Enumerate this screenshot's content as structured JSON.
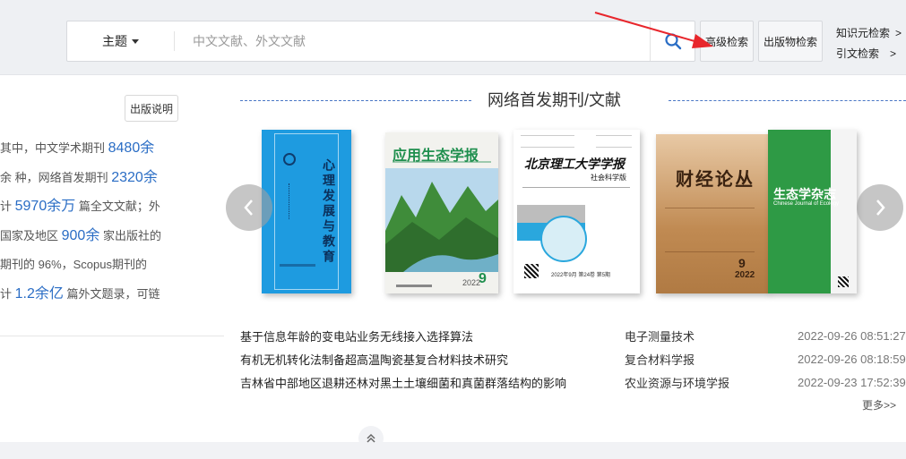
{
  "search": {
    "subject_label": "主题",
    "placeholder": "中文文献、外文文献"
  },
  "buttons": {
    "advanced": "高级检索",
    "publication": "出版物检索"
  },
  "side_links": {
    "knowledge": "知识元检索",
    "citation": "引文检索",
    "arrow": ">"
  },
  "intro": {
    "pub_note": "出版说明",
    "lines": [
      [
        "其中，中文学术期刊 ",
        "8480余",
        ""
      ],
      [
        "余 种，网络首发期刊 ",
        "2320余",
        ""
      ],
      [
        "计 ",
        "5970余万",
        " 篇全文文献；外"
      ],
      [
        "国家及地区 ",
        "900余",
        " 家出版社的"
      ],
      [
        "期刊的 96%，Scopus期刊的",
        "",
        ""
      ],
      [
        "计 ",
        "1.2余亿",
        " 篇外文题录，可链"
      ]
    ]
  },
  "section": {
    "title": "网络首发期刊/文献"
  },
  "covers": [
    {
      "title": "心理发展与教育",
      "color": "#1e9be0"
    },
    {
      "title": "应用生态学报",
      "color": "#f2f2ee",
      "issue": "9",
      "year": "2022"
    },
    {
      "title": "北京理工大学学报",
      "subtitle": "社会科学版",
      "color": "#ffffff",
      "footer": "2022年9月 第24卷 第5期"
    },
    {
      "title": "财经论丛",
      "color": "#c08a52",
      "issue": "9",
      "year": "2022"
    },
    {
      "title": "生态学杂志",
      "subtitle": "Chinese Journal of Ecology",
      "color": "#2e9a45"
    }
  ],
  "articles": [
    {
      "title": "基于信息年龄的变电站业务无线接入选择算法",
      "source": "电子测量技术",
      "date": "2022-09-26 08:51:27"
    },
    {
      "title": "有机无机转化法制备超高温陶瓷基复合材料技术研究",
      "source": "复合材料学报",
      "date": "2022-09-26 08:18:59"
    },
    {
      "title": "吉林省中部地区退耕还林对黑土土壤细菌和真菌群落结构的影响",
      "source": "农业资源与环境学报",
      "date": "2022-09-23 17:52:39"
    }
  ],
  "more": "更多>>",
  "colors": {
    "accent": "#2a6dc5",
    "annotation_arrow": "#e8262c"
  }
}
